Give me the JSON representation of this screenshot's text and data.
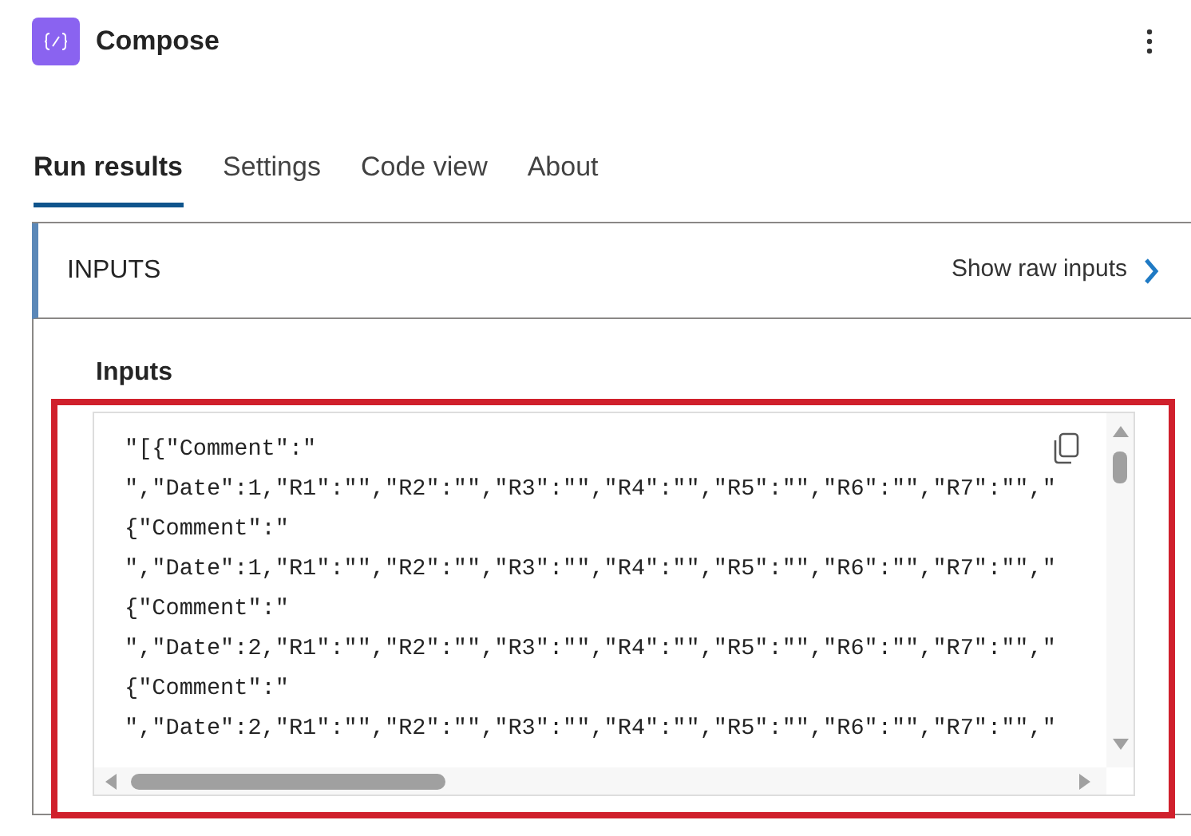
{
  "header": {
    "title": "Compose"
  },
  "tabs": [
    {
      "label": "Run results",
      "selected": true
    },
    {
      "label": "Settings",
      "selected": false
    },
    {
      "label": "Code view",
      "selected": false
    },
    {
      "label": "About",
      "selected": false
    }
  ],
  "section": {
    "title": "INPUTS",
    "link": "Show raw inputs",
    "field_label": "Inputs",
    "code_lines": [
      "\"[{\"Comment\":\"",
      "\",\"Date\":1,\"R1\":\"\",\"R2\":\"\",\"R3\":\"\",\"R4\":\"\",\"R5\":\"\",\"R6\":\"\",\"R7\":\"\",\"",
      "{\"Comment\":\"",
      "\",\"Date\":1,\"R1\":\"\",\"R2\":\"\",\"R3\":\"\",\"R4\":\"\",\"R5\":\"\",\"R6\":\"\",\"R7\":\"\",\"",
      "{\"Comment\":\"",
      "\",\"Date\":2,\"R1\":\"\",\"R2\":\"\",\"R3\":\"\",\"R4\":\"\",\"R5\":\"\",\"R6\":\"\",\"R7\":\"\",\"",
      "{\"Comment\":\"",
      "\",\"Date\":2,\"R1\":\"\",\"R2\":\"\",\"R3\":\"\",\"R4\":\"\",\"R5\":\"\",\"R6\":\"\",\"R7\":\"\",\""
    ]
  }
}
